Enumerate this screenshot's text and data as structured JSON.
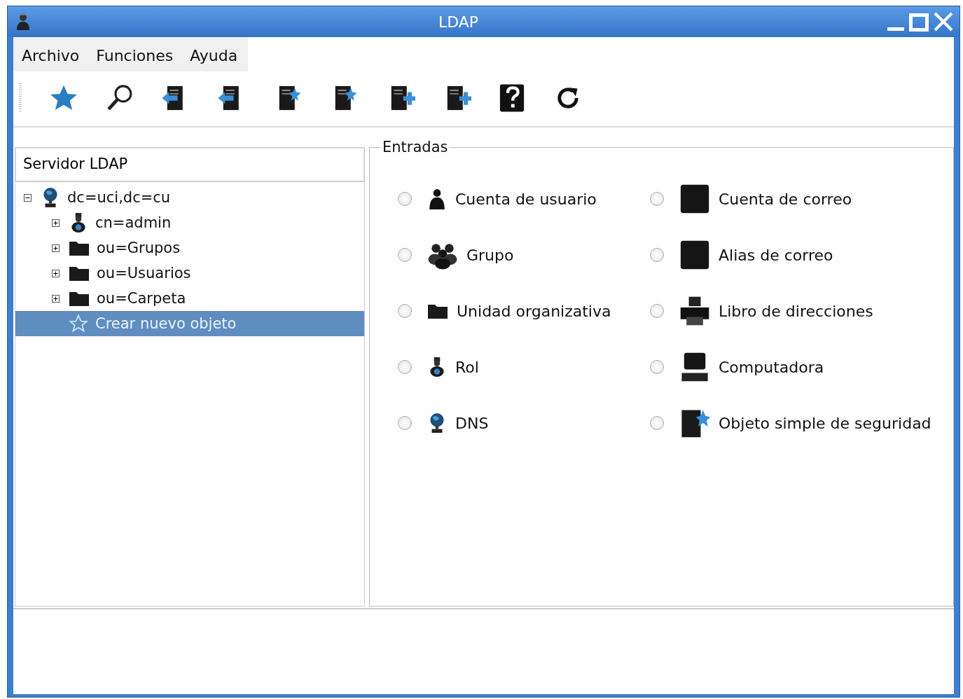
{
  "window": {
    "title": "LDAP"
  },
  "menu": [
    "Archivo",
    "Funciones",
    "Ayuda"
  ],
  "tree_panel": {
    "header": "Servidor LDAP",
    "tree": [
      {
        "label": "dc=uci,dc=cu",
        "kind": "globe",
        "expanded": true,
        "selected": false,
        "children": [
          {
            "label": "cn=admin",
            "kind": "user",
            "expanded": false,
            "selected": false
          },
          {
            "label": "ou=Grupos",
            "kind": "folder",
            "expanded": false,
            "selected": false
          },
          {
            "label": "ou=Usuarios",
            "kind": "folder",
            "expanded": false,
            "selected": false
          },
          {
            "label": "ou=Carpeta",
            "kind": "folder",
            "expanded": false,
            "selected": false
          },
          {
            "label": "Crear nuevo objeto",
            "kind": "star",
            "selected": true
          }
        ]
      }
    ]
  },
  "entries": {
    "title": "Entradas",
    "options": [
      {
        "label": "Cuenta de usuario",
        "kind": "person",
        "selected": false
      },
      {
        "label": "Cuenta de correo",
        "kind": "mail",
        "selected": false
      },
      {
        "label": "Grupo",
        "kind": "group",
        "selected": false
      },
      {
        "label": "Alias de correo",
        "kind": "mail",
        "selected": false
      },
      {
        "label": "Unidad organizativa",
        "kind": "folder",
        "selected": false
      },
      {
        "label": "Libro de direcciones",
        "kind": "printer",
        "selected": false
      },
      {
        "label": "Rol",
        "kind": "role",
        "selected": false
      },
      {
        "label": "Computadora",
        "kind": "computer",
        "selected": false
      },
      {
        "label": "DNS",
        "kind": "globe",
        "selected": false
      },
      {
        "label": "Objeto simple de seguridad",
        "kind": "document",
        "selected": false
      }
    ]
  }
}
